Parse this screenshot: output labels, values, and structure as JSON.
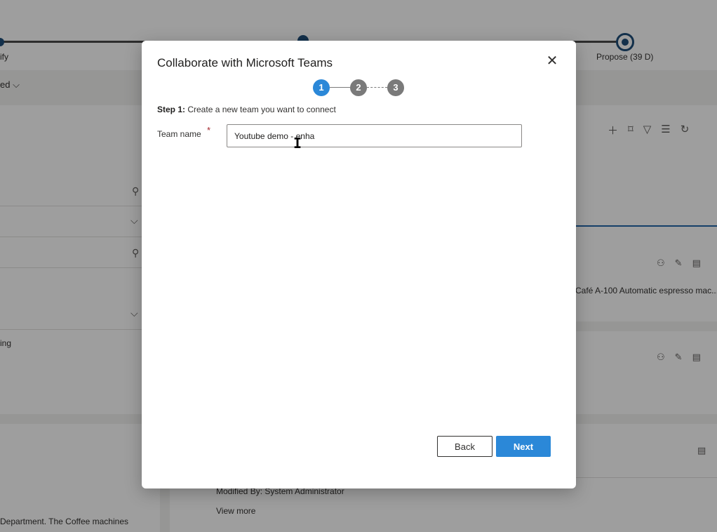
{
  "background": {
    "process_stages": {
      "left_stage": "ify",
      "right_stage": "Propose  (39 D)"
    },
    "left_filter_label": "ed",
    "left_row_text": "ing",
    "left_bottom_text": "Department. The Coffee machines",
    "right_card_text": "Café A-100 Automatic espresso mac...",
    "bottom_card": {
      "modified_by": "Modified By: System Administrator",
      "view_more": "View more"
    }
  },
  "dialog": {
    "title": "Collaborate with Microsoft Teams",
    "close_glyph": "✕",
    "steps": [
      "1",
      "2",
      "3"
    ],
    "active_step": 1,
    "step_prefix": "Step 1:",
    "step_text": " Create a new team you want to connect",
    "team_name": {
      "label": "Team name",
      "required_mark": "*",
      "value": "Youtube demo - enha"
    },
    "buttons": {
      "back": "Back",
      "next": "Next"
    }
  },
  "colors": {
    "accent": "#2b88d8",
    "step_inactive": "#7a7a7a",
    "required": "#a4262c"
  },
  "icons": [
    "close-icon",
    "search-icon",
    "chevron-down-icon",
    "add-icon",
    "bookmark-icon",
    "filter-icon",
    "list-icon",
    "refresh-icon",
    "person-icon",
    "note-icon",
    "text-cursor-icon"
  ]
}
